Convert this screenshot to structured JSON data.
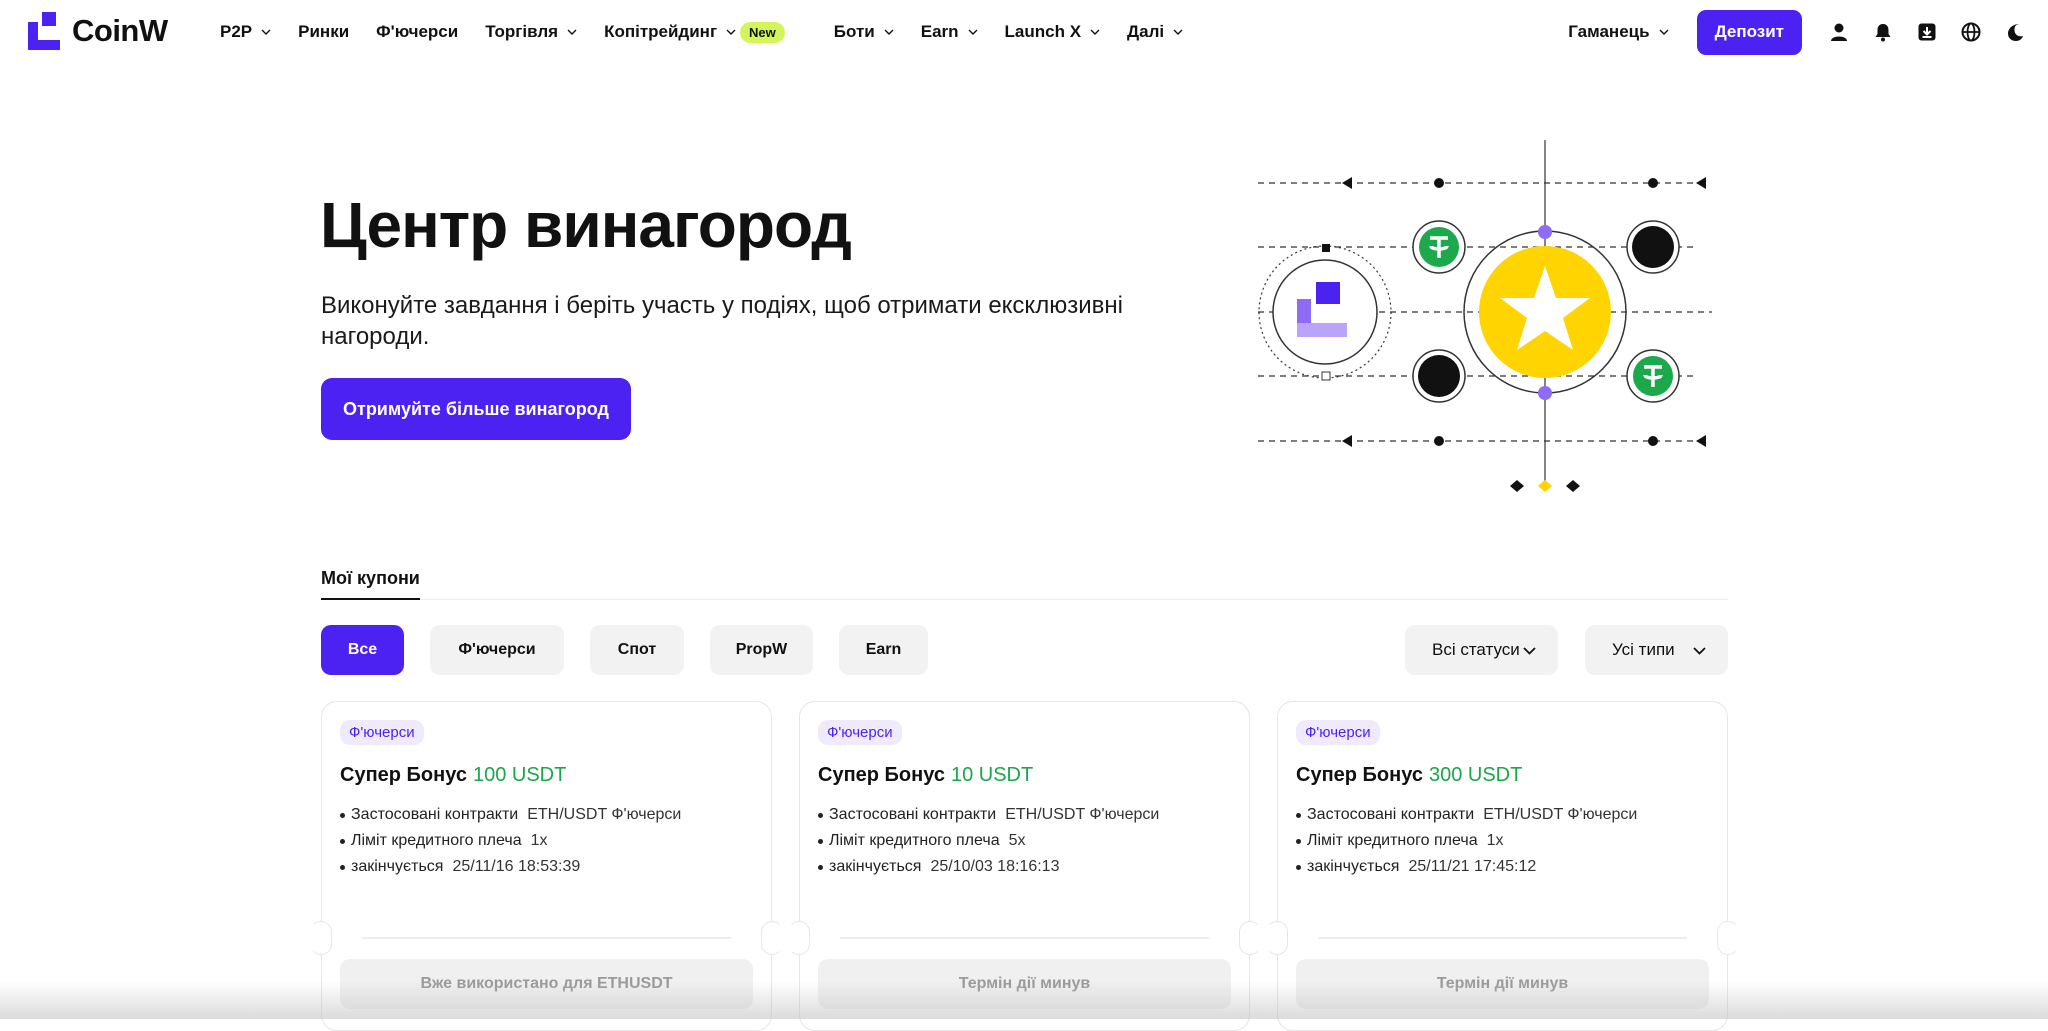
{
  "brand": {
    "name": "CoinW",
    "accent": "#4b22f2"
  },
  "nav": {
    "items": [
      {
        "label": "P2P",
        "dropdown": true
      },
      {
        "label": "Ринки",
        "dropdown": false
      },
      {
        "label": "Ф'ючерси",
        "dropdown": false
      },
      {
        "label": "Торгівля",
        "dropdown": true
      },
      {
        "label": "Копітрейдинг",
        "dropdown": true,
        "badge": "New"
      },
      {
        "label": "Боти",
        "dropdown": true
      },
      {
        "label": "Earn",
        "dropdown": true
      },
      {
        "label": "Launch X",
        "dropdown": true
      },
      {
        "label": "Далі",
        "dropdown": true
      }
    ],
    "wallet_label": "Гаманець",
    "deposit_label": "Депозит",
    "icons": [
      "user-icon",
      "bell-icon",
      "download-icon",
      "globe-icon",
      "moon-icon"
    ]
  },
  "hero": {
    "title": "Центр винагород",
    "subtitle": "Виконуйте завдання і беріть участь у подіях, щоб отримати ексклюзивні нагороди.",
    "cta_label": "Отримуйте більше винагород"
  },
  "tabs": {
    "active": "Мої купони"
  },
  "filters": {
    "chips": [
      {
        "label": "Все",
        "active": true
      },
      {
        "label": "Ф'ючерси",
        "active": false
      },
      {
        "label": "Спот",
        "active": false
      },
      {
        "label": "PropW",
        "active": false
      },
      {
        "label": "Earn",
        "active": false
      }
    ],
    "status_dropdown": "Всі статуси",
    "type_dropdown": "Усі типи"
  },
  "coupons": [
    {
      "tag": "Ф'ючерси",
      "title": "Супер Бонус",
      "amount": "100 USDT",
      "contracts_label": "Застосовані контракти",
      "contracts_value": "ETH/USDT Ф'ючерси",
      "leverage_label": "Ліміт кредитного плеча",
      "leverage_value": "1x",
      "expires_label": "закінчується",
      "expires_value": "25/11/16 18:53:39",
      "status": "Вже використано для ETHUSDT"
    },
    {
      "tag": "Ф'ючерси",
      "title": "Супер Бонус",
      "amount": "10 USDT",
      "contracts_label": "Застосовані контракти",
      "contracts_value": "ETH/USDT Ф'ючерси",
      "leverage_label": "Ліміт кредитного плеча",
      "leverage_value": "5x",
      "expires_label": "закінчується",
      "expires_value": "25/10/03 18:16:13",
      "status": "Термін дії минув"
    },
    {
      "tag": "Ф'ючерси",
      "title": "Супер Бонус",
      "amount": "300 USDT",
      "contracts_label": "Застосовані контракти",
      "contracts_value": "ETH/USDT Ф'ючерси",
      "leverage_label": "Ліміт кредитного плеча",
      "leverage_value": "1x",
      "expires_label": "закінчується",
      "expires_value": "25/11/21 17:45:12",
      "status": "Термін дії минув"
    }
  ],
  "colors": {
    "green": "#1aa64a",
    "yellow": "#ffd400",
    "tether": "#1ba94c"
  }
}
